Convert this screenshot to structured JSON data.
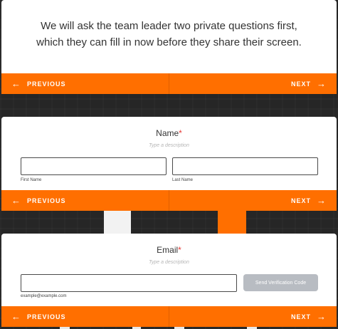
{
  "intro": {
    "line1": "We will ask the team leader two private questions first,",
    "line2": "which they can fill in now before they share their screen."
  },
  "nav": {
    "previous_label": "PREVIOUS",
    "next_label": "NEXT",
    "previous_arrow": "←",
    "next_arrow": "→"
  },
  "name_field": {
    "label": "Name",
    "required_marker": "*",
    "description": "Type a description",
    "first_sublabel": "First Name",
    "last_sublabel": "Last Name",
    "first_value": "",
    "last_value": ""
  },
  "email_field": {
    "label": "Email",
    "required_marker": "*",
    "description": "Type a description",
    "value": "",
    "example": "example@example.com",
    "verify_button": "Send Verification Code"
  },
  "colors": {
    "accent": "#ff6f00",
    "required": "#e53935",
    "disabled_button": "#b8bcc2",
    "background": "#262626"
  }
}
